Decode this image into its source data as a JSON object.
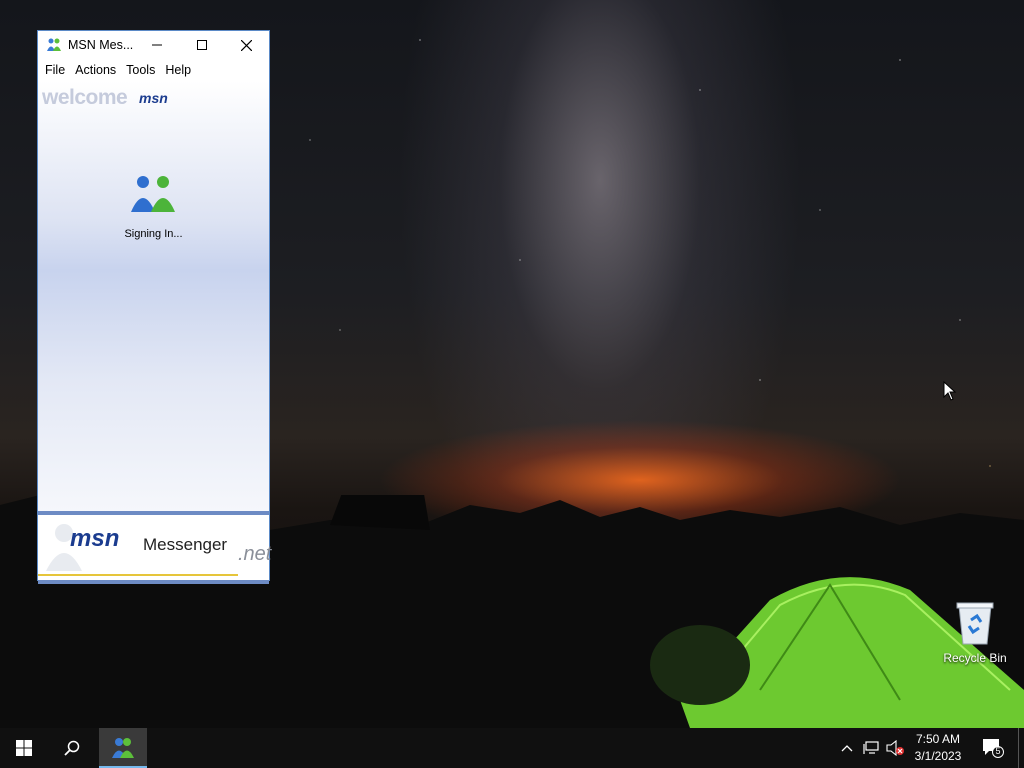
{
  "window": {
    "title": "MSN Mes...",
    "menu": [
      "File",
      "Actions",
      "Tools",
      "Help"
    ],
    "welcome_word": "welcome",
    "welcome_brand": "msn",
    "status_text": "Signing In...",
    "banner_brand": "msn",
    "banner_product": "Messenger",
    "banner_suffix": ".net"
  },
  "desktop": {
    "recycle_bin_label": "Recycle Bin"
  },
  "taskbar": {
    "time": "7:50 AM",
    "date": "3/1/2023",
    "notification_count": "5"
  },
  "icons": {
    "start": "windows-logo-icon",
    "search": "search-icon",
    "app": "msn-messenger-icon",
    "tray_up": "chevron-up-icon",
    "network": "network-icon",
    "volume": "volume-muted-icon",
    "notifications": "action-center-icon"
  },
  "colors": {
    "accent": "#76b9ed",
    "msn_blue": "#1b3c8f",
    "banner_stripe": "#6d8bc4"
  }
}
